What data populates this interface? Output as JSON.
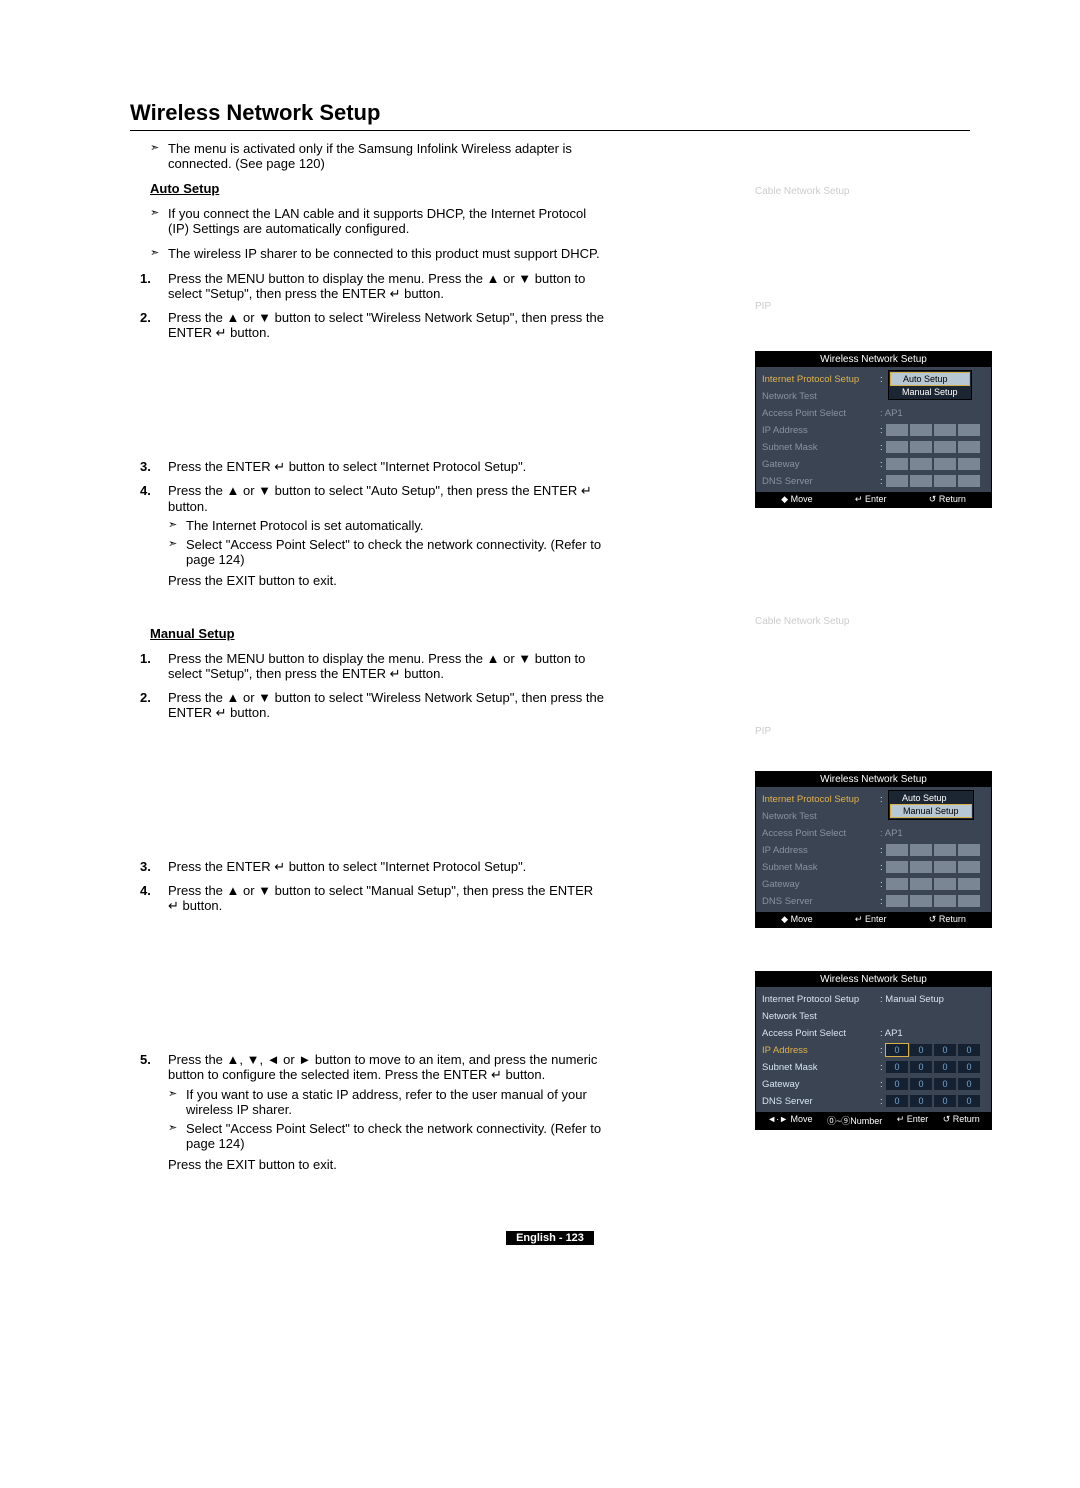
{
  "title": "Wireless Network Setup",
  "intro_note": "The menu is activated only if the Samsung Infolink Wireless adapter is connected. (See page 120)",
  "auto": {
    "heading": "Auto Setup",
    "notes": [
      "If you connect the LAN cable and it supports DHCP, the Internet Protocol (IP) Settings are automatically configured.",
      "The wireless IP sharer to be connected to this product must support DHCP."
    ],
    "steps": [
      "Press the MENU button to display the menu. Press the ▲ or ▼ button to select \"Setup\", then press the ENTER ↵ button.",
      "Press the ▲ or ▼ button to select \"Wireless Network Setup\", then press the ENTER ↵ button.",
      "Press the ENTER ↵ button to select \"Internet Protocol Setup\".",
      "Press the ▲ or ▼ button to select \"Auto Setup\", then press the ENTER ↵ button."
    ],
    "subnotes": [
      "The Internet Protocol is set automatically.",
      "Select \"Access Point Select\" to check the network connectivity. (Refer to page 124)"
    ],
    "exit": "Press the EXIT button to exit."
  },
  "manual": {
    "heading": "Manual Setup",
    "steps": [
      "Press the MENU button to display the menu. Press the ▲ or ▼ button to select \"Setup\", then press the ENTER ↵ button.",
      "Press the ▲ or ▼ button to select \"Wireless Network Setup\", then press the ENTER ↵ button.",
      "Press the ENTER ↵ button to select \"Internet Protocol Setup\".",
      "Press the ▲ or ▼ button to select \"Manual Setup\", then press the ENTER ↵ button.",
      "Press the ▲, ▼, ◄ or ► button to move to an item, and press the numeric button to configure the selected item. Press the ENTER ↵ button."
    ],
    "subnotes": [
      "If you want to use a static IP address, refer to the user manual of your wireless IP sharer.",
      "Select \"Access Point Select\" to check the network connectivity. (Refer to page 124)"
    ],
    "exit": "Press the EXIT button to exit."
  },
  "ghost": {
    "cable": "Cable Network Setup",
    "pip": "PIP"
  },
  "osd": {
    "title": "Wireless Network Setup",
    "rows": {
      "ips": "Internet Protocol Setup",
      "nt": "Network Test",
      "ap": "Access Point Select",
      "ap_val": ": AP1",
      "ip": "IP Address",
      "sn": "Subnet Mask",
      "gw": "Gateway",
      "dns": "DNS Server"
    },
    "option_auto": "Auto Setup",
    "option_manual": "Manual Setup",
    "manual_val": ": Manual Setup",
    "zero": "0",
    "footer": {
      "move": "◆ Move",
      "movelr": "◄·► Move",
      "number": "⓪~⑨Number",
      "enter": "↵ Enter",
      "return": "↺ Return"
    }
  },
  "pagenum": "English - 123"
}
